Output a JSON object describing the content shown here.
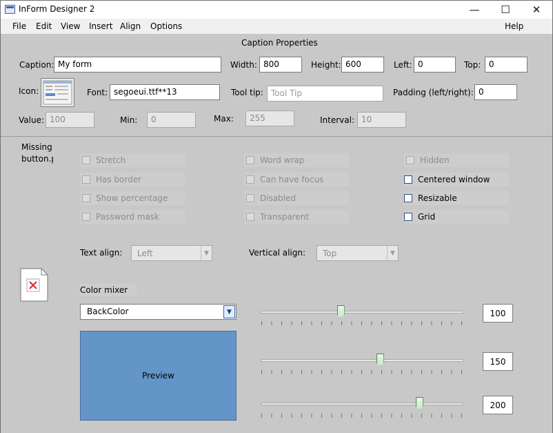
{
  "window": {
    "title": "InForm Designer 2",
    "minimize": "—",
    "maximize": "☐",
    "close": "✕"
  },
  "menu": {
    "file": "File",
    "edit": "Edit",
    "view": "View",
    "insert": "Insert",
    "align": "Align",
    "options": "Options",
    "help": "Help"
  },
  "caption_properties": {
    "header": "Caption Properties",
    "caption_label": "Caption:",
    "caption_value": "My form",
    "width_label": "Width:",
    "width_value": "800",
    "height_label": "Height:",
    "height_value": "600",
    "left_label": "Left:",
    "left_value": "0",
    "top_label": "Top:",
    "top_value": "0",
    "icon_label": "Icon:",
    "font_label": "Font:",
    "font_value": "segoeui.ttf**13",
    "tooltip_label": "Tool tip:",
    "tooltip_placeholder": "Tool Tip",
    "padding_label": "Padding (left/right):",
    "padding_value": "0",
    "value_label": "Value:",
    "value_value": "100",
    "min_label": "Min:",
    "min_value": "0",
    "max_label": "Max:",
    "max_value": "255",
    "interval_label": "Interval:",
    "interval_value": "10"
  },
  "missing_image": {
    "text_line1": "Missing",
    "text_line2": "button.p"
  },
  "options": {
    "stretch": "Stretch",
    "has_border": "Has border",
    "show_percentage": "Show percentage",
    "password_mask": "Password mask",
    "word_wrap": "Word wrap",
    "can_have_focus": "Can have focus",
    "disabled": "Disabled",
    "transparent": "Transparent",
    "hidden": "Hidden",
    "centered_window": "Centered window",
    "resizable": "Resizable",
    "grid": "Grid"
  },
  "alignment": {
    "text_align_label": "Text align:",
    "text_align_value": "Left",
    "vertical_align_label": "Vertical align:",
    "vertical_align_value": "Top"
  },
  "color_mixer": {
    "label": "Color mixer",
    "target": "BackColor",
    "preview_label": "Preview",
    "preview_color": "#6495c8",
    "red": 100,
    "green": 150,
    "blue": 200,
    "red_text": "100",
    "green_text": "150",
    "blue_text": "200",
    "max": 255
  }
}
